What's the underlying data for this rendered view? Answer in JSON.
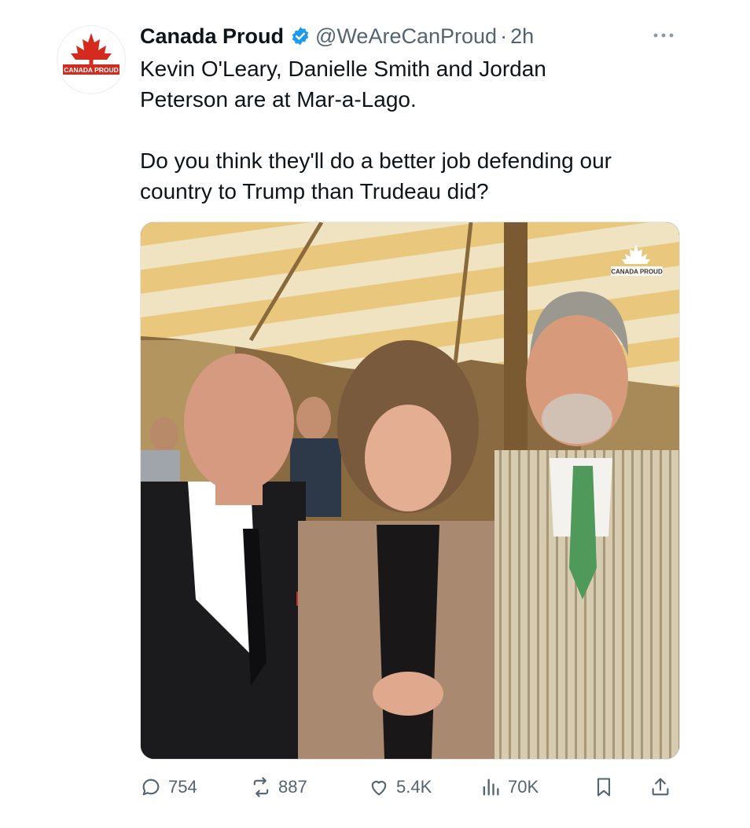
{
  "tweet": {
    "author_name": "Canada Proud",
    "handle": "@WeAreCanProud",
    "separator": "·",
    "time": "2h",
    "avatar_text": "CANADA PROUD",
    "text": "Kevin O'Leary, Danielle Smith and Jordan\nPeterson are at Mar-a-Lago.\n\nDo you think they'll do a better job defending our\ncountry to Trump than Trudeau did?",
    "media": {
      "watermark": "CANADA PROUD"
    },
    "actions": {
      "replies": "754",
      "reposts": "887",
      "likes": "5.4K",
      "views": "70K"
    }
  },
  "colors": {
    "brand_red": "#d52b1e",
    "verified_blue": "#1d9bf0",
    "secondary_text": "#536471"
  },
  "icons": [
    "verified-badge-icon",
    "more-icon",
    "reply-icon",
    "repost-icon",
    "like-icon",
    "views-icon",
    "bookmark-icon",
    "share-icon"
  ]
}
